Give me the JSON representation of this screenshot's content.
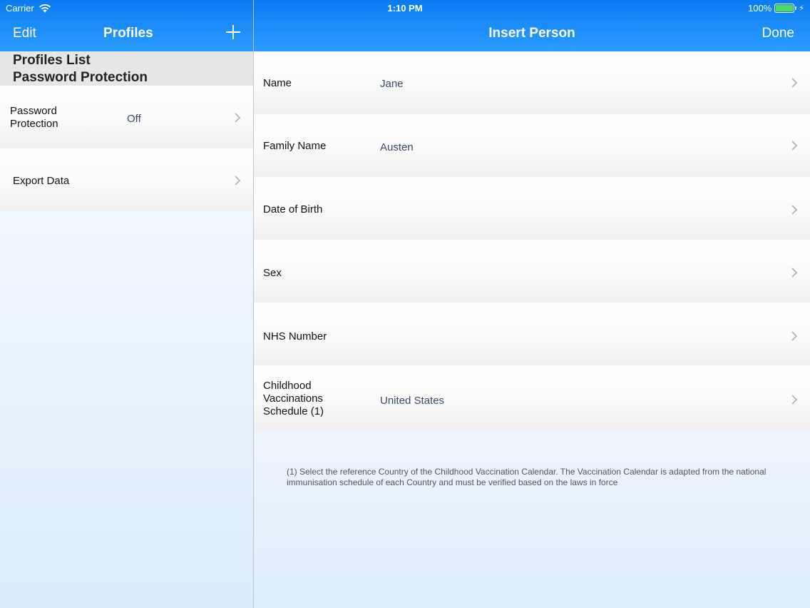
{
  "status_bar": {
    "carrier": "Carrier",
    "time": "1:10 PM",
    "battery": "100%"
  },
  "nav_left": {
    "edit": "Edit",
    "title": "Profiles",
    "add_icon": "plus-icon"
  },
  "nav_right": {
    "title": "Insert Person",
    "done": "Done"
  },
  "left_pane": {
    "header_line1": "Profiles List",
    "header_line2": "Password Protection",
    "rows": [
      {
        "label": "Password Protection",
        "value": "Off"
      },
      {
        "label": "Export Data",
        "value": ""
      }
    ]
  },
  "form": {
    "rows": [
      {
        "label": "Name",
        "value": "Jane"
      },
      {
        "label": "Family Name",
        "value": "Austen"
      },
      {
        "label": "Date of Birth",
        "value": ""
      },
      {
        "label": "Sex",
        "value": ""
      },
      {
        "label": "NHS Number",
        "value": ""
      },
      {
        "label": "Childhood Vaccinations Schedule (1)",
        "value": "United States"
      }
    ],
    "footnote": "(1) Select the reference Country of the Childhood Vaccination Calendar. The Vaccination Calendar is adapted from the national immunisation schedule of each Country and must be verified based on the laws in force"
  },
  "colors": {
    "nav_blue": "#1d8ef8",
    "battery_green": "#4cd964",
    "value_text": "#3a4a62"
  }
}
